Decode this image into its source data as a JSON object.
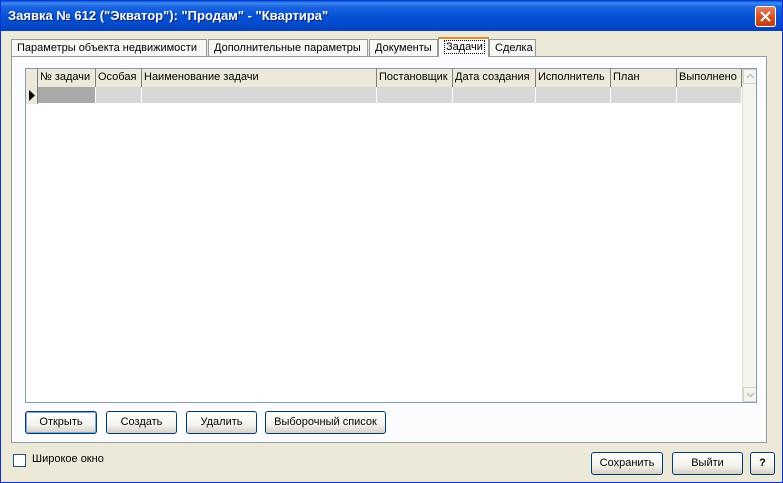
{
  "window": {
    "title": "Заявка № 612 (\"Экватор\"): \"Продам\" - \"Квартира\""
  },
  "tabs": [
    {
      "label": "Параметры объекта недвижимости"
    },
    {
      "label": "Дополнительные параметры"
    },
    {
      "label": "Документы"
    },
    {
      "label": "Задачи",
      "active": true
    },
    {
      "label": "Сделка"
    }
  ],
  "grid": {
    "columns": [
      "№ задачи",
      "Особая",
      "Наименование задачи",
      "Постановщик",
      "Дата создания",
      "Исполнитель",
      "План",
      "Выполнено"
    ],
    "rows": [
      [
        "",
        "",
        "",
        "",
        "",
        "",
        "",
        ""
      ]
    ]
  },
  "actions": {
    "open": "Открыть",
    "create": "Создать",
    "delete": "Удалить",
    "selection_list": "Выборочный список"
  },
  "footer": {
    "wide_window_label": "Широкое окно",
    "wide_window_checked": false,
    "save": "Сохранить",
    "exit": "Выйти",
    "help": "?"
  },
  "colors": {
    "titlebar": "#0552d6",
    "face": "#ece9d8",
    "active_tab_accent": "#e68b2c",
    "row_fill": "#d8d8d8",
    "selected_cell": "#a9a9a9"
  },
  "icons": [
    "close-icon",
    "row-pointer-icon",
    "scroll-up-icon",
    "scroll-down-icon"
  ]
}
